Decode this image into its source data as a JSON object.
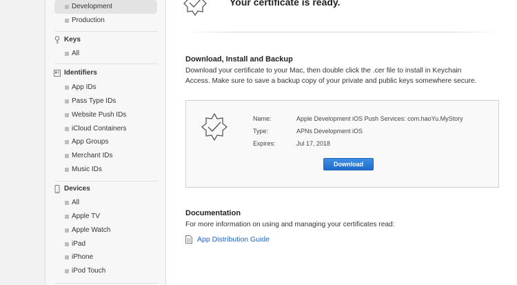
{
  "sidebar": {
    "development": "Development",
    "production": "Production",
    "keys_header": "Keys",
    "keys_all": "All",
    "identifiers_header": "Identifiers",
    "identifiers": [
      "App IDs",
      "Pass Type IDs",
      "Website Push IDs",
      "iCloud Containers",
      "App Groups",
      "Merchant IDs",
      "Music IDs"
    ],
    "devices_header": "Devices",
    "devices": [
      "All",
      "Apple TV",
      "Apple Watch",
      "iPad",
      "iPhone",
      "iPod Touch"
    ]
  },
  "main": {
    "ready_title": "Your certificate is ready.",
    "download_heading": "Download, Install and Backup",
    "download_text_1": "Download your certificate to your Mac, then double click the .cer file to install in Keychain",
    "download_text_2": "Access. Make sure to save a backup copy of your private and public keys somewhere secure.",
    "cert": {
      "name_label": "Name:",
      "name_value": "Apple Development iOS Push Services: com.haoYu.MyStory",
      "type_label": "Type:",
      "type_value": "APNs Development iOS",
      "expires_label": "Expires:",
      "expires_value": "Jul 17, 2018",
      "download_button": "Download"
    },
    "doc_heading": "Documentation",
    "doc_text": "For more information on using and managing your certificates read:",
    "doc_link": "App Distribution Guide"
  },
  "colors": {
    "accent": "#1f6dcc",
    "link": "#1d64c8"
  }
}
